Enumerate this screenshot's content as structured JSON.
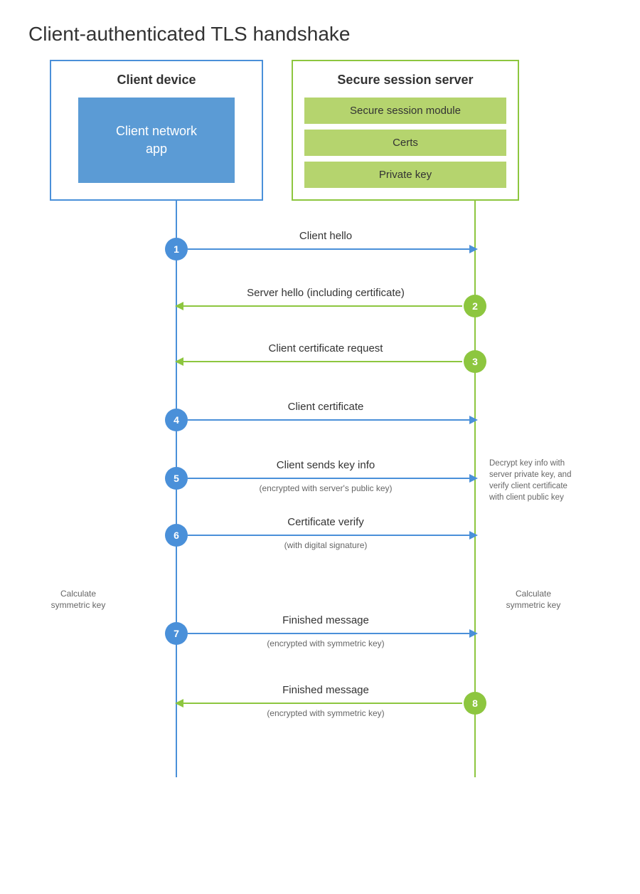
{
  "title": "Client-authenticated TLS handshake",
  "client_box": {
    "title": "Client device",
    "inner_label": "Client network\napp"
  },
  "server_box": {
    "title": "Secure session server",
    "components": [
      "Secure session module",
      "Certs",
      "Private key"
    ]
  },
  "steps": [
    {
      "num": "1",
      "color": "blue",
      "num_side": "left",
      "direction": "right",
      "label": "Client hello",
      "sublabel": ""
    },
    {
      "num": "2",
      "color": "green",
      "num_side": "right",
      "direction": "left",
      "label": "Server hello (including certificate)",
      "sublabel": ""
    },
    {
      "num": "3",
      "color": "green",
      "num_side": "right",
      "direction": "left",
      "label": "Client certificate request",
      "sublabel": ""
    },
    {
      "num": "4",
      "color": "blue",
      "num_side": "left",
      "direction": "right",
      "label": "Client certificate",
      "sublabel": ""
    },
    {
      "num": "5",
      "color": "blue",
      "num_side": "left",
      "direction": "right",
      "label": "Client sends key info",
      "sublabel": "(encrypted with server's public key)"
    },
    {
      "num": "6",
      "color": "blue",
      "num_side": "left",
      "direction": "right",
      "label": "Certificate verify",
      "sublabel": "(with digital signature)"
    },
    {
      "num": "7",
      "color": "blue",
      "num_side": "left",
      "direction": "right",
      "label": "Finished message",
      "sublabel": "(encrypted with symmetric key)"
    },
    {
      "num": "8",
      "color": "green",
      "num_side": "right",
      "direction": "left",
      "label": "Finished message",
      "sublabel": "(encrypted with symmetric key)"
    }
  ],
  "side_notes": {
    "decrypt_note": "Decrypt key info with\nserver private key, and\nverify client certificate\nwith client public key",
    "calc_sym_client": "Calculate\nsymmetric key",
    "calc_sym_server": "Calculate\nsymmetric key"
  }
}
